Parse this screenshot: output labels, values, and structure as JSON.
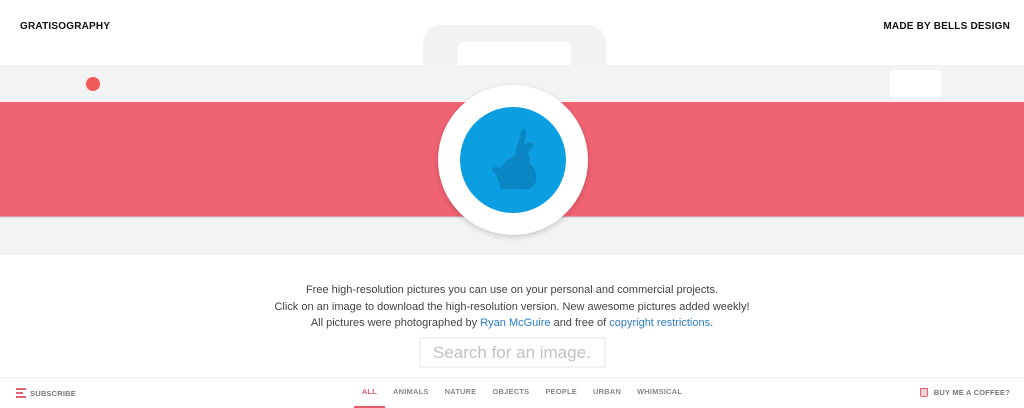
{
  "header": {
    "brand": "GRATISOGRAPHY",
    "credit": "MADE BY BELLS DESIGN"
  },
  "intro": {
    "line1": "Free high-resolution pictures you can use on your personal and commercial projects.",
    "line2": "Click on an image to download the high-resolution version. New awesome pictures added weekly!",
    "line3_prefix": "All pictures were photographed by ",
    "photographer_link": "Ryan McGuire",
    "line3_middle": " and free of ",
    "copyright_link": "copyright restrictions",
    "line3_suffix": "."
  },
  "search": {
    "placeholder": "Search for an image..."
  },
  "bottom": {
    "subscribe_label": "SUBSCRIBE",
    "coffee_label": "BUY ME A COFFEE?",
    "categories": [
      "ALL",
      "ANIMALS",
      "NATURE",
      "OBJECTS",
      "PEOPLE",
      "URBAN",
      "WHIMSICAL"
    ],
    "active_category": "ALL"
  },
  "colors": {
    "stripe": "#f06373",
    "lens": "#0b9ee0",
    "accent": "#e85a69",
    "link": "#2b7cc8"
  }
}
